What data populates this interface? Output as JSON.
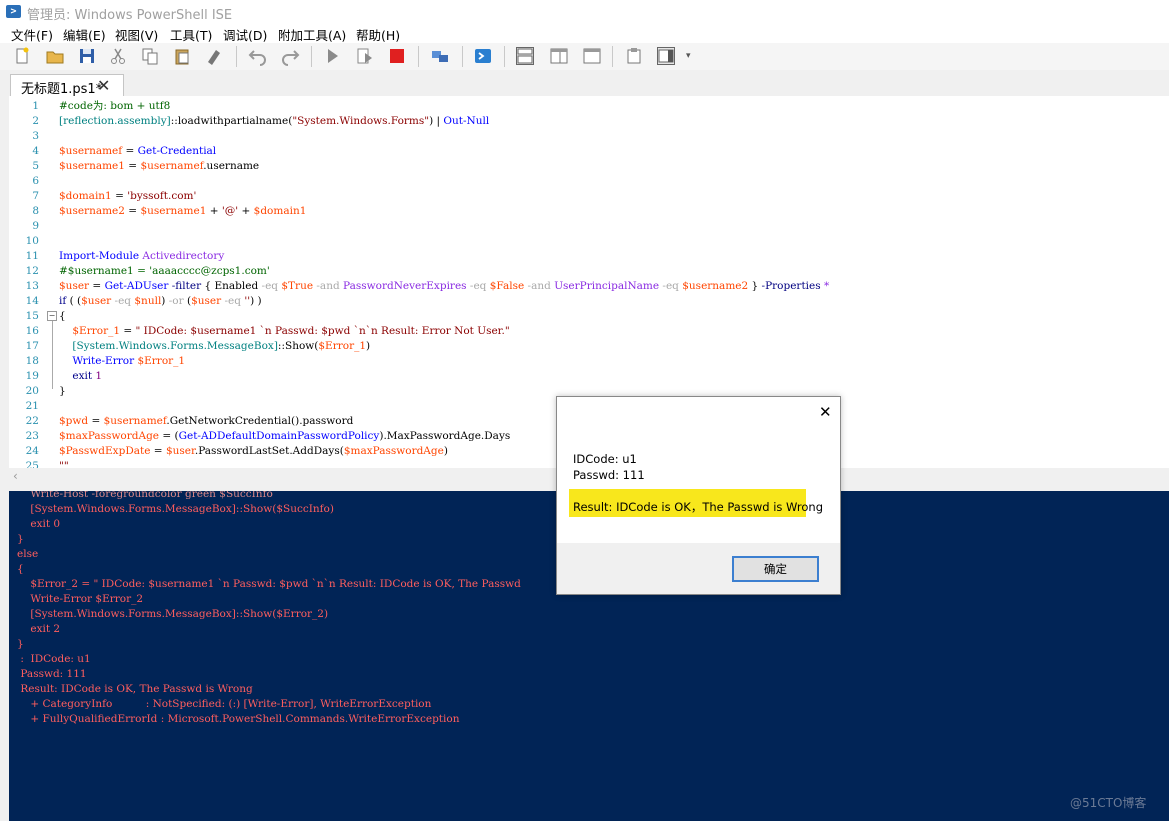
{
  "window": {
    "title": "管理员: Windows PowerShell ISE"
  },
  "menu": [
    "文件(F)",
    "编辑(E)",
    "视图(V)",
    "工具(T)",
    "调试(D)",
    "附加工具(A)",
    "帮助(H)"
  ],
  "toolbar": [
    "new-icon",
    "open-icon",
    "save-icon",
    "cut-icon",
    "copy-icon",
    "paste-icon",
    "clear-icon",
    "undo-icon",
    "redo-icon",
    "run-icon",
    "run-selection-icon",
    "stop-icon",
    "remote-icon",
    "powershell-icon",
    "layout-top-icon",
    "layout-right-icon",
    "layout-max-icon",
    "commands-icon",
    "addon-icon"
  ],
  "tab": {
    "label": "无标题1.ps1*"
  },
  "editor": {
    "lines": [
      {
        "n": "1",
        "segs": [
          [
            "#code为: bom + utf8",
            "#006400"
          ]
        ]
      },
      {
        "n": "2",
        "segs": [
          [
            "[reflection.assembly]",
            "#008080"
          ],
          [
            "::loadwithpartialname(",
            "#000"
          ],
          [
            "\"System.Windows.Forms\"",
            "#8b0000"
          ],
          [
            ") | ",
            "#000"
          ],
          [
            "Out-Null",
            "#0000ff"
          ]
        ]
      },
      {
        "n": "3",
        "segs": []
      },
      {
        "n": "4",
        "segs": [
          [
            "$usernamef",
            "#ff4500"
          ],
          [
            " = ",
            "#000"
          ],
          [
            "Get-Credential",
            "#0000ff"
          ]
        ]
      },
      {
        "n": "5",
        "segs": [
          [
            "$username1",
            "#ff4500"
          ],
          [
            " = ",
            "#000"
          ],
          [
            "$usernamef",
            "#ff4500"
          ],
          [
            ".username",
            "#000"
          ]
        ]
      },
      {
        "n": "6",
        "segs": []
      },
      {
        "n": "7",
        "segs": [
          [
            "$domain1",
            "#ff4500"
          ],
          [
            " = ",
            "#000"
          ],
          [
            "'byssoft.com'",
            "#8b0000"
          ]
        ]
      },
      {
        "n": "8",
        "segs": [
          [
            "$username2",
            "#ff4500"
          ],
          [
            " = ",
            "#000"
          ],
          [
            "$username1",
            "#ff4500"
          ],
          [
            " + ",
            "#000"
          ],
          [
            "'@'",
            "#8b0000"
          ],
          [
            " + ",
            "#000"
          ],
          [
            "$domain1",
            "#ff4500"
          ]
        ]
      },
      {
        "n": "9",
        "segs": []
      },
      {
        "n": "10",
        "segs": []
      },
      {
        "n": "11",
        "segs": [
          [
            "Import-Module",
            "#0000ff"
          ],
          [
            " Activedirectory",
            "#8a2be2"
          ]
        ]
      },
      {
        "n": "12",
        "segs": [
          [
            "#$username1 = 'aaaacccc@zcps1.com'",
            "#006400"
          ]
        ]
      },
      {
        "n": "13",
        "segs": [
          [
            "$user",
            "#ff4500"
          ],
          [
            " = ",
            "#000"
          ],
          [
            "Get-ADUser",
            "#0000ff"
          ],
          [
            " -filter ",
            "#000080"
          ],
          [
            "{ ",
            "#000"
          ],
          [
            "Enabled",
            "#000"
          ],
          [
            " -eq ",
            "#a9a9a9"
          ],
          [
            "$True",
            "#ff4500"
          ],
          [
            " -and ",
            "#a9a9a9"
          ],
          [
            "PasswordNeverExpires",
            "#8a2be2"
          ],
          [
            " -eq ",
            "#a9a9a9"
          ],
          [
            "$False",
            "#ff4500"
          ],
          [
            " -and ",
            "#a9a9a9"
          ],
          [
            "UserPrincipalName",
            "#8a2be2"
          ],
          [
            " -eq ",
            "#a9a9a9"
          ],
          [
            "$username2",
            "#ff4500"
          ],
          [
            " } ",
            "#000"
          ],
          [
            "-Properties",
            "#000080"
          ],
          [
            " *",
            "#8a2be2"
          ]
        ]
      },
      {
        "n": "14",
        "segs": [
          [
            "if",
            "#00008b"
          ],
          [
            " ( (",
            "#000"
          ],
          [
            "$user",
            "#ff4500"
          ],
          [
            " -eq ",
            "#a9a9a9"
          ],
          [
            "$null",
            "#ff4500"
          ],
          [
            ") ",
            "#000"
          ],
          [
            "-or",
            "#a9a9a9"
          ],
          [
            " (",
            "#000"
          ],
          [
            "$user",
            "#ff4500"
          ],
          [
            " -eq ",
            "#a9a9a9"
          ],
          [
            "''",
            "#8b0000"
          ],
          [
            ") )",
            "#000"
          ]
        ]
      },
      {
        "n": "15",
        "segs": [
          [
            "{",
            "#000"
          ]
        ]
      },
      {
        "n": "16",
        "segs": [
          [
            "    ",
            "#000"
          ],
          [
            "$Error_1",
            "#ff4500"
          ],
          [
            " = ",
            "#000"
          ],
          [
            "\" IDCode: $username1 `n Passwd: $pwd `n`n Result: Error Not User.\"",
            "#8b0000"
          ]
        ]
      },
      {
        "n": "17",
        "segs": [
          [
            "    ",
            "#000"
          ],
          [
            "[System.Windows.Forms.MessageBox]",
            "#008080"
          ],
          [
            "::Show(",
            "#000"
          ],
          [
            "$Error_1",
            "#ff4500"
          ],
          [
            ")",
            "#000"
          ]
        ]
      },
      {
        "n": "18",
        "segs": [
          [
            "    ",
            "#000"
          ],
          [
            "Write-Error",
            "#0000ff"
          ],
          [
            " ",
            "#000"
          ],
          [
            "$Error_1",
            "#ff4500"
          ]
        ]
      },
      {
        "n": "19",
        "segs": [
          [
            "    ",
            "#000"
          ],
          [
            "exit",
            "#00008b"
          ],
          [
            " 1",
            "#800080"
          ]
        ]
      },
      {
        "n": "20",
        "segs": [
          [
            "}",
            "#000"
          ]
        ]
      },
      {
        "n": "21",
        "segs": []
      },
      {
        "n": "22",
        "segs": [
          [
            "$pwd",
            "#ff4500"
          ],
          [
            " = ",
            "#000"
          ],
          [
            "$usernamef",
            "#ff4500"
          ],
          [
            ".GetNetworkCredential().password",
            "#000"
          ]
        ]
      },
      {
        "n": "23",
        "segs": [
          [
            "$maxPasswordAge",
            "#ff4500"
          ],
          [
            " = (",
            "#000"
          ],
          [
            "Get-ADDefaultDomainPasswordPolicy",
            "#0000ff"
          ],
          [
            ").MaxPasswordAge.Days",
            "#000"
          ]
        ]
      },
      {
        "n": "24",
        "segs": [
          [
            "$PasswdExpDate",
            "#ff4500"
          ],
          [
            " = ",
            "#000"
          ],
          [
            "$user",
            "#ff4500"
          ],
          [
            ".PasswordLastSet.AddDays(",
            "#000"
          ],
          [
            "$maxPasswordAge",
            "#ff4500"
          ],
          [
            ")",
            "#000"
          ]
        ]
      },
      {
        "n": "25",
        "segs": [
          [
            "\"\"",
            "#8b0000"
          ]
        ]
      }
    ]
  },
  "console": {
    "lines": [
      "    Write-Host -foregroundcolor green $SuccInfo",
      "    [System.Windows.Forms.MessageBox]::Show($SuccInfo)",
      "    exit 0",
      "}",
      "else",
      "{",
      "    $Error_2 = \" IDCode: $username1 `n Passwd: $pwd `n`n Result: IDCode is OK, The Passwd",
      "    Write-Error $Error_2",
      "    [System.Windows.Forms.MessageBox]::Show($Error_2)",
      "    exit 2",
      "}",
      " :  IDCode: u1",
      " Passwd: 111",
      " Result: IDCode is OK, The Passwd is Wrong",
      "    + CategoryInfo          : NotSpecified: (:) [Write-Error], WriteErrorException",
      "    + FullyQualifiedErrorId : Microsoft.PowerShell.Commands.WriteErrorException"
    ]
  },
  "dialog": {
    "line1": "IDCode: u1",
    "line2": "Passwd: 111",
    "result": "Result: IDCode is OK，The Passwd is Wrong",
    "ok_label": "确定"
  },
  "watermark": "@51CTO博客",
  "colors": {
    "console_bg": "#012456",
    "console_error": "#ff5e5e",
    "highlight": "#f8e71c"
  }
}
